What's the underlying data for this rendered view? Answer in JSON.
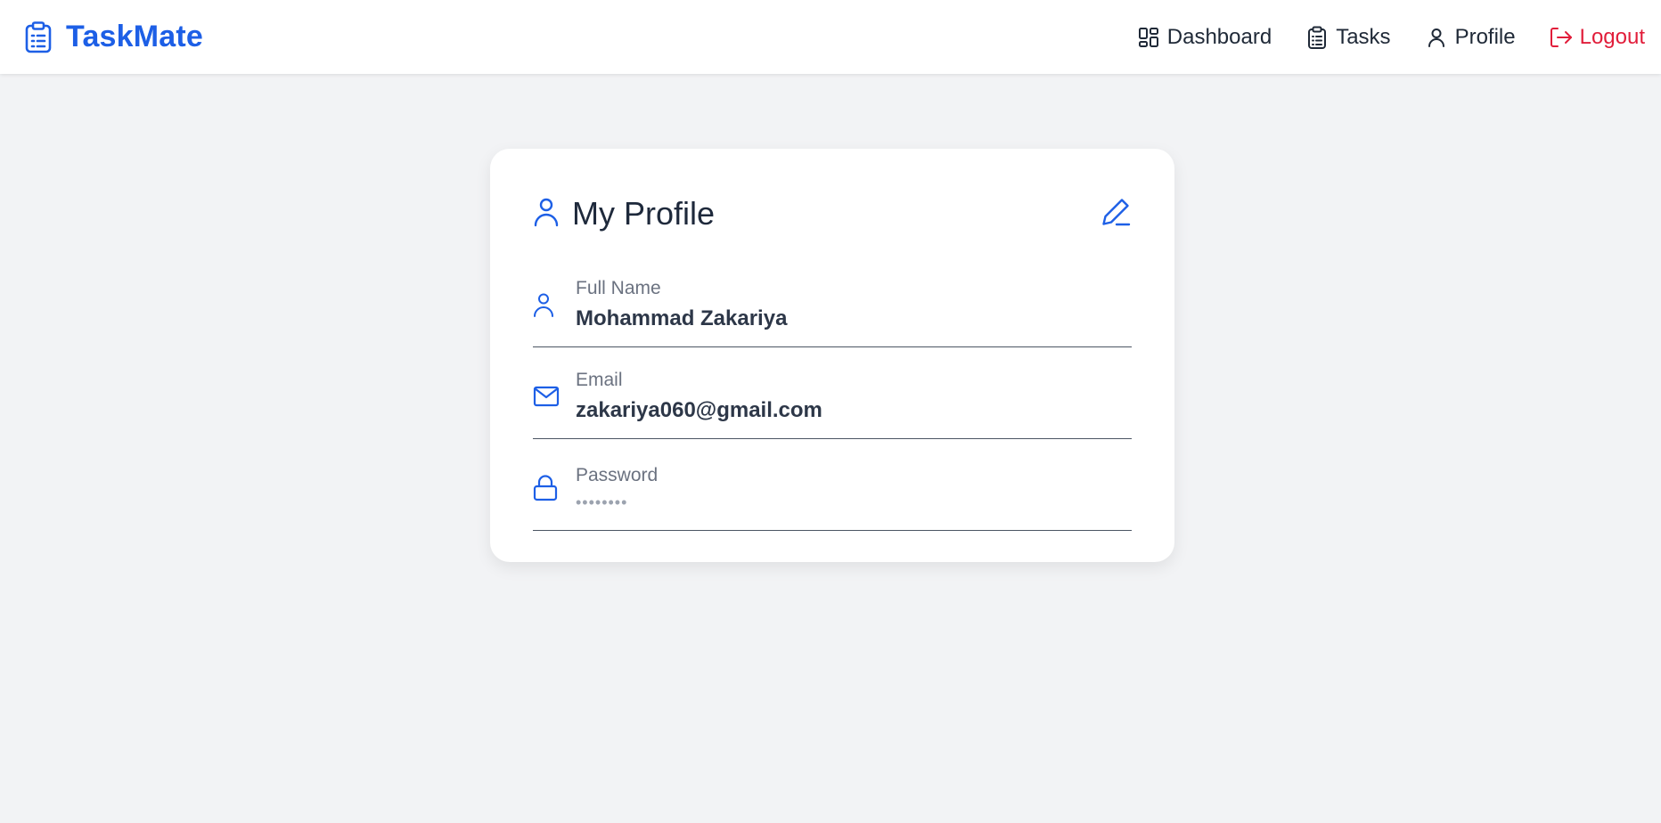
{
  "app": {
    "brand_name": "TaskMate",
    "brand_icon": "clipboard-list-icon",
    "brand_color": "#1d5fe6"
  },
  "nav": {
    "items": [
      {
        "label": "Dashboard",
        "icon": "layout-grid-icon"
      },
      {
        "label": "Tasks",
        "icon": "clipboard-list-icon"
      },
      {
        "label": "Profile",
        "icon": "user-icon"
      },
      {
        "label": "Logout",
        "icon": "logout-icon",
        "color": "#e11d3a"
      }
    ]
  },
  "profile": {
    "title": "My Profile",
    "title_icon": "user-icon",
    "edit_icon": "pencil-icon",
    "fields": [
      {
        "label": "Full Name",
        "value": "Mohammad Zakariya",
        "icon": "user-icon"
      },
      {
        "label": "Email",
        "value": "zakariya060@gmail.com",
        "icon": "mail-icon"
      },
      {
        "label": "Password",
        "value": "••••••••",
        "icon": "lock-icon"
      }
    ]
  },
  "colors": {
    "accent": "#1d5fe6",
    "danger": "#e11d3a",
    "background": "#f2f3f5"
  }
}
